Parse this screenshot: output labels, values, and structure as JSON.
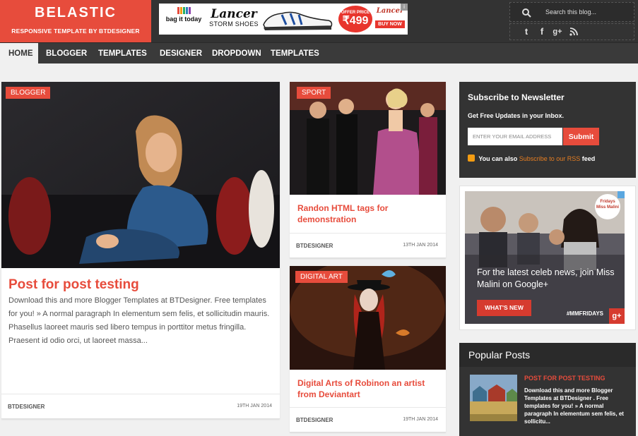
{
  "header": {
    "logo_title": "BELASTIC",
    "logo_tagline": "RESPONSIVE TEMPLATE BY BTDESIGNER",
    "search_placeholder": "Search this blog...",
    "accent_color": "#e74c3c",
    "social_icons": [
      "twitter-icon",
      "facebook-icon",
      "google-plus-icon",
      "rss-icon"
    ]
  },
  "ad_banner": {
    "brand1": "bag it today",
    "brand2": "Lancer",
    "brand2_sub": "STORM SHOES",
    "offer_label": "OFFER PRICE",
    "price": "₹499",
    "brand3": "Lancer",
    "cta": "BUY NOW"
  },
  "nav": {
    "items": [
      {
        "label": "HOME",
        "active": true
      },
      {
        "label": "BLOGGER"
      },
      {
        "label": "TEMPLATES"
      },
      {
        "label": "DESIGNER"
      },
      {
        "label": "DROPDOWN"
      },
      {
        "label": "TEMPLATES"
      }
    ]
  },
  "posts": [
    {
      "category": "BLOGGER",
      "title": "Post for post testing",
      "excerpt": "Download this and more Blogger Templates at BTDesigner. Free templates for you! » A normal paragraph In elementum sem felis, et sollicitudin mauris. Phasellus laoreet mauris sed libero tempus in porttitor metus fringilla. Praesent id odio orci, ut laoreet massa...",
      "author": "BTDESIGNER",
      "date": "19TH JAN 2014"
    },
    {
      "category": "SPORT",
      "title": "Randon HTML tags for demonstration",
      "author": "BTDESIGNER",
      "date": "13TH JAN 2014"
    },
    {
      "category": "DIGITAL ART",
      "title": "Digital Arts of Robinon an artist from Deviantart",
      "author": "BTDESIGNER",
      "date": "19TH JAN 2014"
    }
  ],
  "newsletter": {
    "title": "Subscribe to Newsletter",
    "subtitle": "Get Free Updates in your Inbox.",
    "email_placeholder": "ENTER YOUR EMAIL ADDRESS",
    "submit_label": "Submit",
    "rss_prefix": "You can also",
    "rss_link": "Subscribe to our RSS",
    "rss_suffix": "feed"
  },
  "side_ad": {
    "text": "For the latest celeb news, join Miss Malini on Google+",
    "button": "WHAT'S NEW",
    "hashtag": "#MMFRIDAYS",
    "logo_text": "Fridays Miss Malini",
    "gplus": "g+"
  },
  "popular": {
    "heading": "Popular Posts",
    "item_title": "POST FOR POST TESTING",
    "item_text": "Download this and more Blogger Templates at BTDesigner . Free templates for you! » A normal paragraph In elementum sem felis, et sollicitu..."
  }
}
